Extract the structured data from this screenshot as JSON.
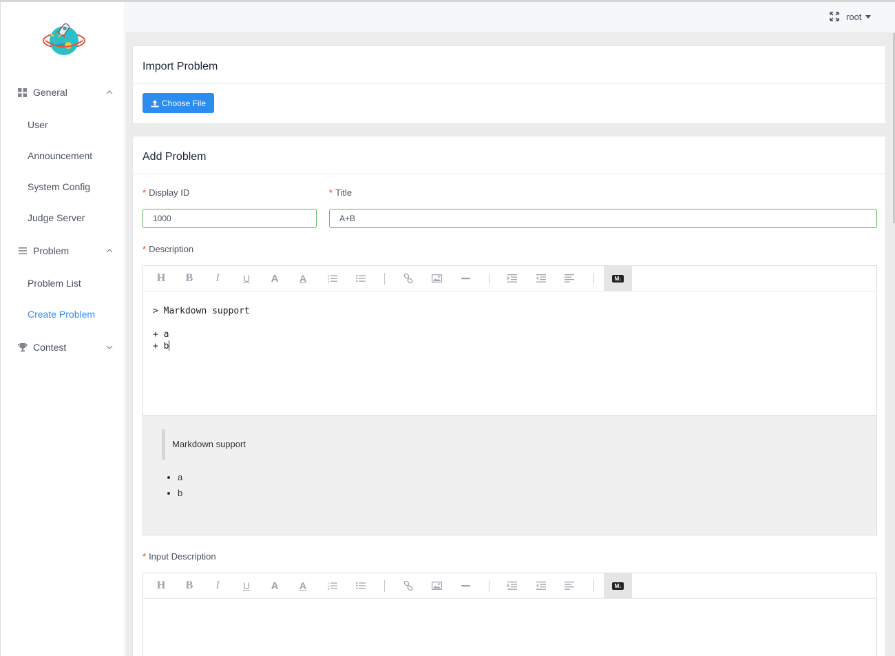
{
  "user": {
    "name": "root"
  },
  "sidebar": {
    "groups": [
      {
        "label": "General",
        "items": [
          "User",
          "Announcement",
          "System Config",
          "Judge Server"
        ]
      },
      {
        "label": "Problem",
        "items": [
          "Problem List",
          "Create Problem"
        ]
      },
      {
        "label": "Contest",
        "items": []
      }
    ],
    "active_item": "Create Problem"
  },
  "import_card": {
    "title": "Import Problem",
    "button_label": "Choose File"
  },
  "add_card": {
    "title": "Add Problem",
    "display_id": {
      "label": "Display ID",
      "value": "1000"
    },
    "title_field": {
      "label": "Title",
      "value": "A+B"
    },
    "description": {
      "label": "Description",
      "source_lines": [
        "> Markdown support",
        "",
        "+ a",
        "+ b"
      ],
      "preview": {
        "blockquote": "Markdown support",
        "list": [
          "a",
          "b"
        ]
      }
    },
    "input_description": {
      "label": "Input Description"
    }
  },
  "toolbar": {
    "buttons": [
      "H",
      "B",
      "I",
      "U",
      "A",
      "A"
    ],
    "md_label": "M↓",
    "icons": [
      "header-icon",
      "bold-icon",
      "italic-icon",
      "underline-icon",
      "font-icon",
      "font-color-icon",
      "ordered-list-icon",
      "unordered-list-icon",
      "link-icon",
      "image-icon",
      "horizontal-rule-icon",
      "indent-icon",
      "outdent-icon",
      "align-left-icon",
      "markdown-icon"
    ]
  },
  "colors": {
    "accent": "#2d8cf0",
    "valid_border": "#5cb85c",
    "required": "#ed3f14"
  }
}
